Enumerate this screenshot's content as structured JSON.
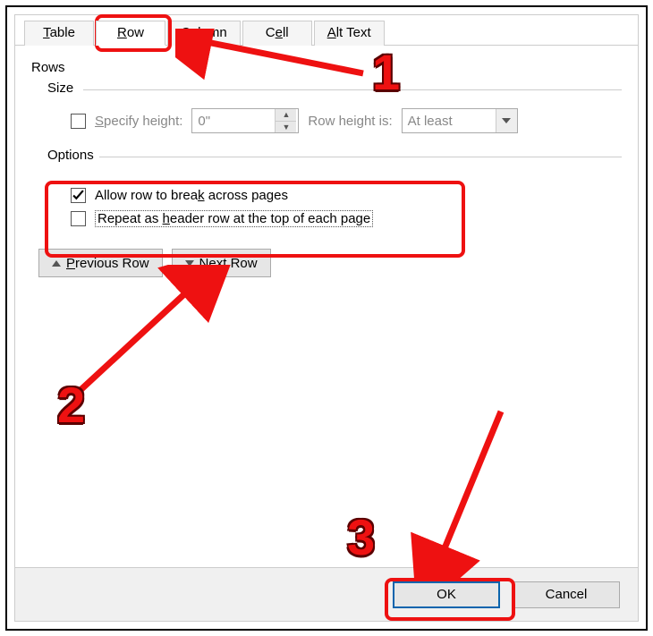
{
  "tabs": {
    "table": "Table",
    "row": "Row",
    "column": "Column",
    "cell": "Cell",
    "alt": "Alt Text"
  },
  "section_rows": "Rows",
  "size": {
    "label": "Size",
    "specify_height": "Specify height:",
    "height_value": "0\"",
    "row_height_is": "Row height is:",
    "at_least": "At least"
  },
  "options": {
    "label": "Options",
    "allow_break": "Allow row to break across pages",
    "repeat_header": "Repeat as header row at the top of each page"
  },
  "nav": {
    "prev": "Previous Row",
    "next": "Next Row"
  },
  "footer": {
    "ok": "OK",
    "cancel": "Cancel"
  },
  "anno": {
    "n1": "1",
    "n2": "2",
    "n3": "3"
  }
}
